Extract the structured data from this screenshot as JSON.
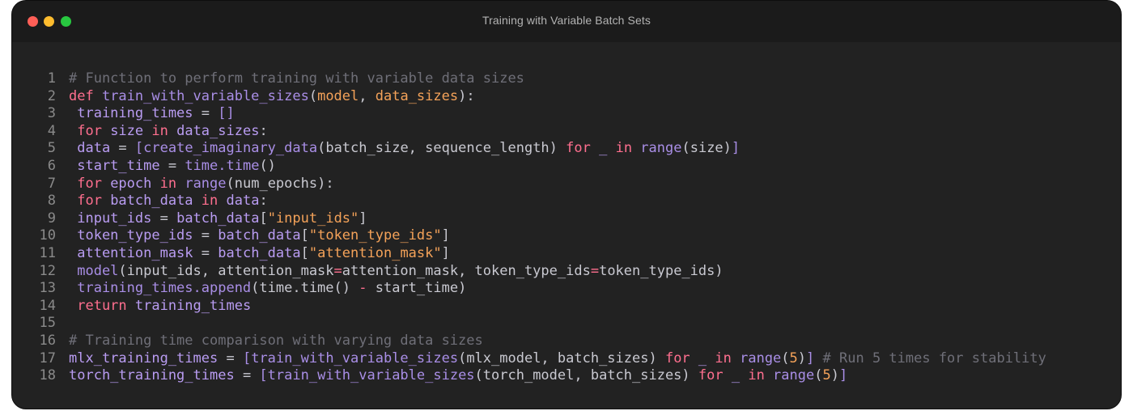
{
  "window": {
    "title": "Training with Variable Batch Sets"
  },
  "code": {
    "lines": [
      {
        "n": "1",
        "tokens": [
          {
            "t": "# Function to perform training with variable data sizes",
            "c": "comment"
          }
        ]
      },
      {
        "n": "2",
        "tokens": [
          {
            "t": "def ",
            "c": "kw"
          },
          {
            "t": "train_with_variable_sizes",
            "c": "fn"
          },
          {
            "t": "(",
            "c": "plain"
          },
          {
            "t": "model",
            "c": "param"
          },
          {
            "t": ", ",
            "c": "plain"
          },
          {
            "t": "data_sizes",
            "c": "param"
          },
          {
            "t": "):",
            "c": "plain"
          }
        ]
      },
      {
        "n": "3",
        "tokens": [
          {
            "t": " training_times ",
            "c": "var"
          },
          {
            "t": "= ",
            "c": "plain"
          },
          {
            "t": "[]",
            "c": "fn"
          }
        ]
      },
      {
        "n": "4",
        "tokens": [
          {
            "t": " for ",
            "c": "kw"
          },
          {
            "t": "size ",
            "c": "var"
          },
          {
            "t": "in ",
            "c": "kw"
          },
          {
            "t": "data_sizes",
            "c": "var"
          },
          {
            "t": ":",
            "c": "plain"
          }
        ]
      },
      {
        "n": "5",
        "tokens": [
          {
            "t": " data ",
            "c": "var"
          },
          {
            "t": "= ",
            "c": "plain"
          },
          {
            "t": "[",
            "c": "fn"
          },
          {
            "t": "create_imaginary_data",
            "c": "fn"
          },
          {
            "t": "(batch_size, sequence_length) ",
            "c": "plain"
          },
          {
            "t": "for ",
            "c": "kw"
          },
          {
            "t": "_ ",
            "c": "var"
          },
          {
            "t": "in ",
            "c": "kw"
          },
          {
            "t": "range",
            "c": "fn"
          },
          {
            "t": "(size)",
            "c": "plain"
          },
          {
            "t": "]",
            "c": "fn"
          }
        ]
      },
      {
        "n": "6",
        "tokens": [
          {
            "t": " start_time ",
            "c": "var"
          },
          {
            "t": "= ",
            "c": "plain"
          },
          {
            "t": "time.time",
            "c": "fn"
          },
          {
            "t": "()",
            "c": "plain"
          }
        ]
      },
      {
        "n": "7",
        "tokens": [
          {
            "t": " for ",
            "c": "kw"
          },
          {
            "t": "epoch ",
            "c": "var"
          },
          {
            "t": "in ",
            "c": "kw"
          },
          {
            "t": "range",
            "c": "fn"
          },
          {
            "t": "(num_epochs):",
            "c": "plain"
          }
        ]
      },
      {
        "n": "8",
        "tokens": [
          {
            "t": " for ",
            "c": "kw"
          },
          {
            "t": "batch_data ",
            "c": "var"
          },
          {
            "t": "in ",
            "c": "kw"
          },
          {
            "t": "data",
            "c": "var"
          },
          {
            "t": ":",
            "c": "plain"
          }
        ]
      },
      {
        "n": "9",
        "tokens": [
          {
            "t": " input_ids ",
            "c": "var"
          },
          {
            "t": "= ",
            "c": "plain"
          },
          {
            "t": "batch_data",
            "c": "var"
          },
          {
            "t": "[",
            "c": "plain"
          },
          {
            "t": "\"input_ids\"",
            "c": "str"
          },
          {
            "t": "]",
            "c": "plain"
          }
        ]
      },
      {
        "n": "10",
        "tokens": [
          {
            "t": " token_type_ids ",
            "c": "var"
          },
          {
            "t": "= ",
            "c": "plain"
          },
          {
            "t": "batch_data",
            "c": "var"
          },
          {
            "t": "[",
            "c": "plain"
          },
          {
            "t": "\"token_type_ids\"",
            "c": "str"
          },
          {
            "t": "]",
            "c": "plain"
          }
        ]
      },
      {
        "n": "11",
        "tokens": [
          {
            "t": " attention_mask ",
            "c": "var"
          },
          {
            "t": "= ",
            "c": "plain"
          },
          {
            "t": "batch_data",
            "c": "var"
          },
          {
            "t": "[",
            "c": "plain"
          },
          {
            "t": "\"attention_mask\"",
            "c": "str"
          },
          {
            "t": "]",
            "c": "plain"
          }
        ]
      },
      {
        "n": "12",
        "tokens": [
          {
            "t": " model",
            "c": "fn"
          },
          {
            "t": "(input_ids, attention_mask",
            "c": "plain"
          },
          {
            "t": "=",
            "c": "kw"
          },
          {
            "t": "attention_mask, token_type_ids",
            "c": "plain"
          },
          {
            "t": "=",
            "c": "kw"
          },
          {
            "t": "token_type_ids)",
            "c": "plain"
          }
        ]
      },
      {
        "n": "13",
        "tokens": [
          {
            "t": " training_times.append",
            "c": "fn"
          },
          {
            "t": "(time.time() ",
            "c": "plain"
          },
          {
            "t": "- ",
            "c": "kw"
          },
          {
            "t": "start_time)",
            "c": "plain"
          }
        ]
      },
      {
        "n": "14",
        "tokens": [
          {
            "t": " return ",
            "c": "kw"
          },
          {
            "t": "training_times",
            "c": "var"
          }
        ]
      },
      {
        "n": "15",
        "tokens": []
      },
      {
        "n": "16",
        "tokens": [
          {
            "t": "# Training time comparison with varying data sizes",
            "c": "comment"
          }
        ]
      },
      {
        "n": "17",
        "tokens": [
          {
            "t": "mlx_training_times ",
            "c": "var"
          },
          {
            "t": "= ",
            "c": "plain"
          },
          {
            "t": "[",
            "c": "fn"
          },
          {
            "t": "train_with_variable_sizes",
            "c": "fn"
          },
          {
            "t": "(mlx_model, batch_sizes) ",
            "c": "plain"
          },
          {
            "t": "for ",
            "c": "kw"
          },
          {
            "t": "_ ",
            "c": "var"
          },
          {
            "t": "in ",
            "c": "kw"
          },
          {
            "t": "range",
            "c": "fn"
          },
          {
            "t": "(",
            "c": "plain"
          },
          {
            "t": "5",
            "c": "num"
          },
          {
            "t": ")",
            "c": "plain"
          },
          {
            "t": "] ",
            "c": "fn"
          },
          {
            "t": "# Run 5 times for stability",
            "c": "comment"
          }
        ]
      },
      {
        "n": "18",
        "tokens": [
          {
            "t": "torch_training_times ",
            "c": "var"
          },
          {
            "t": "= ",
            "c": "plain"
          },
          {
            "t": "[",
            "c": "fn"
          },
          {
            "t": "train_with_variable_sizes",
            "c": "fn"
          },
          {
            "t": "(torch_model, batch_sizes) ",
            "c": "plain"
          },
          {
            "t": "for ",
            "c": "kw"
          },
          {
            "t": "_ ",
            "c": "var"
          },
          {
            "t": "in ",
            "c": "kw"
          },
          {
            "t": "range",
            "c": "fn"
          },
          {
            "t": "(",
            "c": "plain"
          },
          {
            "t": "5",
            "c": "num"
          },
          {
            "t": ")",
            "c": "plain"
          },
          {
            "t": "]",
            "c": "fn"
          }
        ]
      }
    ]
  },
  "colors": {
    "window_bg": "#222222",
    "titlebar_bg": "#1b1b1b",
    "close": "#ff5f57",
    "minimize": "#febc2e",
    "zoom": "#28c840",
    "comment": "#6f6f78",
    "keyword": "#ff6f8f",
    "param": "#f4a259",
    "function": "#a98ee6",
    "string": "#f4a259",
    "variable": "#b99cf2"
  },
  "icons": {
    "close": "close-dot-icon",
    "minimize": "minimize-dot-icon",
    "zoom": "zoom-dot-icon"
  }
}
